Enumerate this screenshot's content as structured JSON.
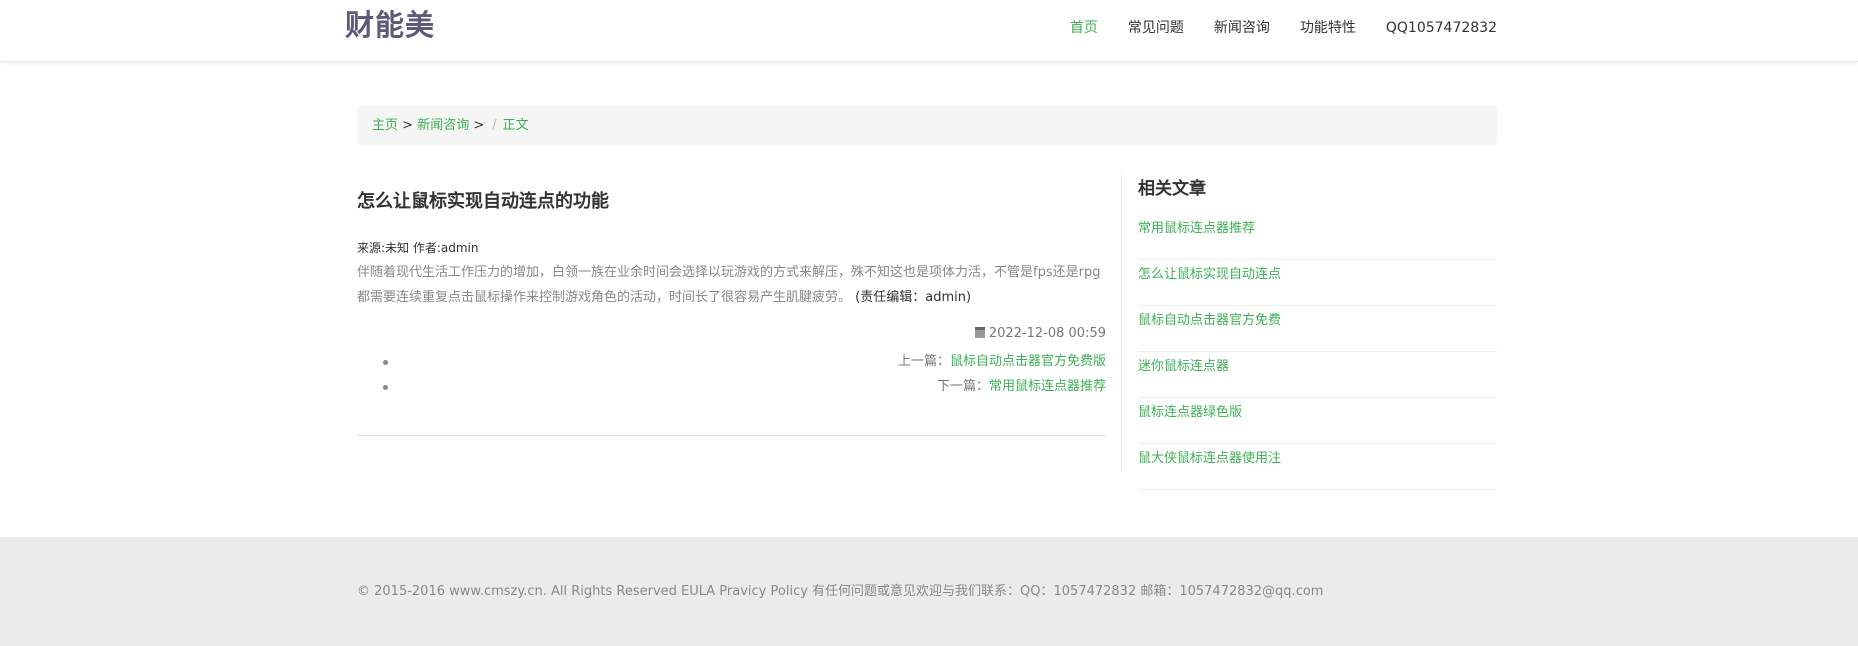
{
  "header": {
    "logo": "财能美",
    "nav": [
      {
        "label": "首页",
        "active": true
      },
      {
        "label": "常见问题",
        "active": false
      },
      {
        "label": "新闻咨询",
        "active": false
      },
      {
        "label": "功能特性",
        "active": false
      },
      {
        "label": "QQ1057472832",
        "active": false
      }
    ]
  },
  "breadcrumb": {
    "home": "主页",
    "sep1": " > ",
    "category": "新闻咨询",
    "sep2": " >",
    "slash": "/",
    "current": "正文"
  },
  "article": {
    "title": "怎么让鼠标实现自动连点的功能",
    "meta": "来源:未知 作者:admin",
    "body": "伴随着现代生活工作压力的增加，白领一族在业余时间会选择以玩游戏的方式来解压，殊不知这也是项体力活，不管是fps还是rpg都需要连续重复点击鼠标操作来控制游戏角色的活动，时间长了很容易产生肌腱疲劳。",
    "editor": "(责任编辑：admin)",
    "date": "2022-12-08 00:59",
    "prev_label": "上一篇：",
    "prev_link": "鼠标自动点击器官方免费版",
    "next_label": "下一篇：",
    "next_link": "常用鼠标连点器推荐"
  },
  "sidebar": {
    "title": "相关文章",
    "items": [
      "常用鼠标连点器推荐",
      "怎么让鼠标实现自动连点",
      "鼠标自动点击器官方免费",
      "迷你鼠标连点器",
      "鼠标连点器绿色版",
      "鼠大侠鼠标连点器使用注"
    ]
  },
  "footer": {
    "text": "© 2015-2016 www.cmszy.cn. All Rights Reserved EULA Pravicy Policy 有任何问题或意见欢迎与我们联系：QQ：1057472832 邮箱：1057472832@qq.com"
  },
  "colors": {
    "accent": "#3db055",
    "logo": "#5e5a7a",
    "footer_bg": "#ebebeb",
    "breadcrumb_bg": "#f5f5f5"
  }
}
